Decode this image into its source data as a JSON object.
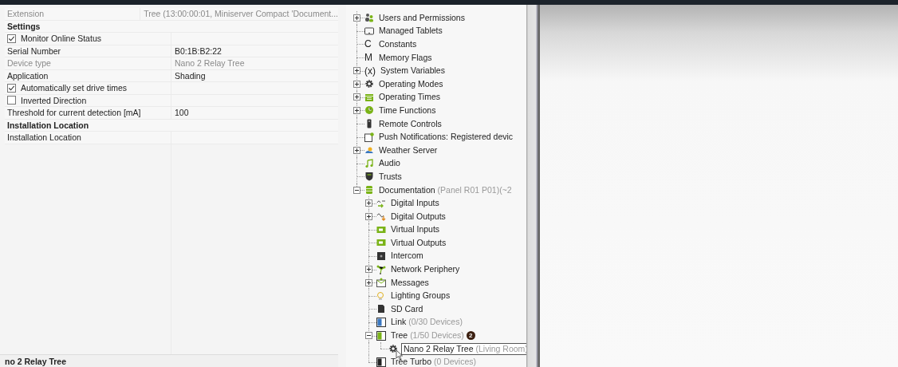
{
  "properties": {
    "rows": [
      {
        "kind": "property",
        "label": "Extension",
        "value": "Tree (13:00:00:01, Miniserver Compact 'Document...",
        "disabled": true
      },
      {
        "kind": "category",
        "label": "Settings"
      },
      {
        "kind": "checkbox",
        "label": "Monitor Online Status",
        "checked": true
      },
      {
        "kind": "property",
        "label": "Serial Number",
        "value": "B0:1B:B2:22",
        "disabled": false
      },
      {
        "kind": "property",
        "label": "Device type",
        "value": "Nano 2 Relay Tree",
        "disabled": true
      },
      {
        "kind": "property",
        "label": "Application",
        "value": "Shading",
        "disabled": false
      },
      {
        "kind": "checkbox",
        "label": "Automatically set drive times",
        "checked": true
      },
      {
        "kind": "checkbox",
        "label": "Inverted Direction",
        "checked": false
      },
      {
        "kind": "property",
        "label": "Threshold for current detection [mA]",
        "value": "100",
        "disabled": false
      },
      {
        "kind": "category",
        "label": "Installation Location"
      },
      {
        "kind": "property",
        "label": "Installation Location",
        "value": "",
        "disabled": false
      }
    ],
    "description_title": "no 2 Relay Tree"
  },
  "tree": {
    "items": [
      {
        "kind": "users",
        "label": "Users and Permissions",
        "expanded": false,
        "selected": false
      },
      {
        "kind": "tablet",
        "label": "Managed Tablets",
        "selected": false
      },
      {
        "kind": "glyph",
        "glyph": "C",
        "label": "Constants",
        "selected": false
      },
      {
        "kind": "glyph",
        "glyph": "M",
        "label": "Memory Flags",
        "selected": false
      },
      {
        "kind": "glyph",
        "glyph": "(x)",
        "label": "System Variables",
        "expanded": false,
        "selected": false
      },
      {
        "kind": "gear",
        "label": "Operating Modes",
        "expanded": false,
        "selected": false
      },
      {
        "kind": "calendar",
        "label": "Operating Times",
        "expanded": false,
        "selected": false
      },
      {
        "kind": "clock",
        "label": "Time Functions",
        "expanded": false,
        "selected": false
      },
      {
        "kind": "remote",
        "label": "Remote Controls",
        "selected": false
      },
      {
        "kind": "notification",
        "label": "Push Notifications: Registered devic",
        "selected": false
      },
      {
        "kind": "weather",
        "label": "Weather Server",
        "expanded": false,
        "selected": false
      },
      {
        "kind": "music",
        "label": "Audio",
        "selected": false
      },
      {
        "kind": "shield",
        "label": "Trusts",
        "selected": false
      },
      {
        "kind": "server",
        "label": "Documentation",
        "suffix": "(Panel R01 P01)(~2",
        "expanded": true,
        "selected": false,
        "children": [
          {
            "kind": "input",
            "label": "Digital Inputs",
            "expanded": false,
            "selected": false
          },
          {
            "kind": "output",
            "label": "Digital Outputs",
            "expanded": false,
            "selected": false
          },
          {
            "kind": "block",
            "label": "Virtual Inputs",
            "selected": false
          },
          {
            "kind": "block",
            "label": "Virtual Outputs",
            "selected": false
          },
          {
            "kind": "intercom",
            "label": "Intercom",
            "selected": false
          },
          {
            "kind": "network",
            "label": "Network Periphery",
            "expanded": false,
            "selected": false
          },
          {
            "kind": "messages",
            "label": "Messages",
            "expanded": false,
            "selected": false
          },
          {
            "kind": "bulb",
            "label": "Lighting Groups",
            "selected": false
          },
          {
            "kind": "sdcard",
            "label": "SD Card",
            "selected": false
          },
          {
            "kind": "link",
            "label": "Link",
            "suffix": "(0/30 Devices)",
            "selected": false
          },
          {
            "kind": "tree",
            "label": "Tree",
            "suffix": "(1/50 Devices)",
            "badge": "2",
            "expanded": true,
            "selected": false,
            "children": [
              {
                "kind": "gear",
                "label": "Nano 2 Relay Tree",
                "suffix": "(Living Room)",
                "selected": true
              }
            ]
          },
          {
            "kind": "treeturbo",
            "label": "Tree Turbo",
            "suffix": "(0 Devices)",
            "selected": false
          }
        ]
      }
    ]
  }
}
